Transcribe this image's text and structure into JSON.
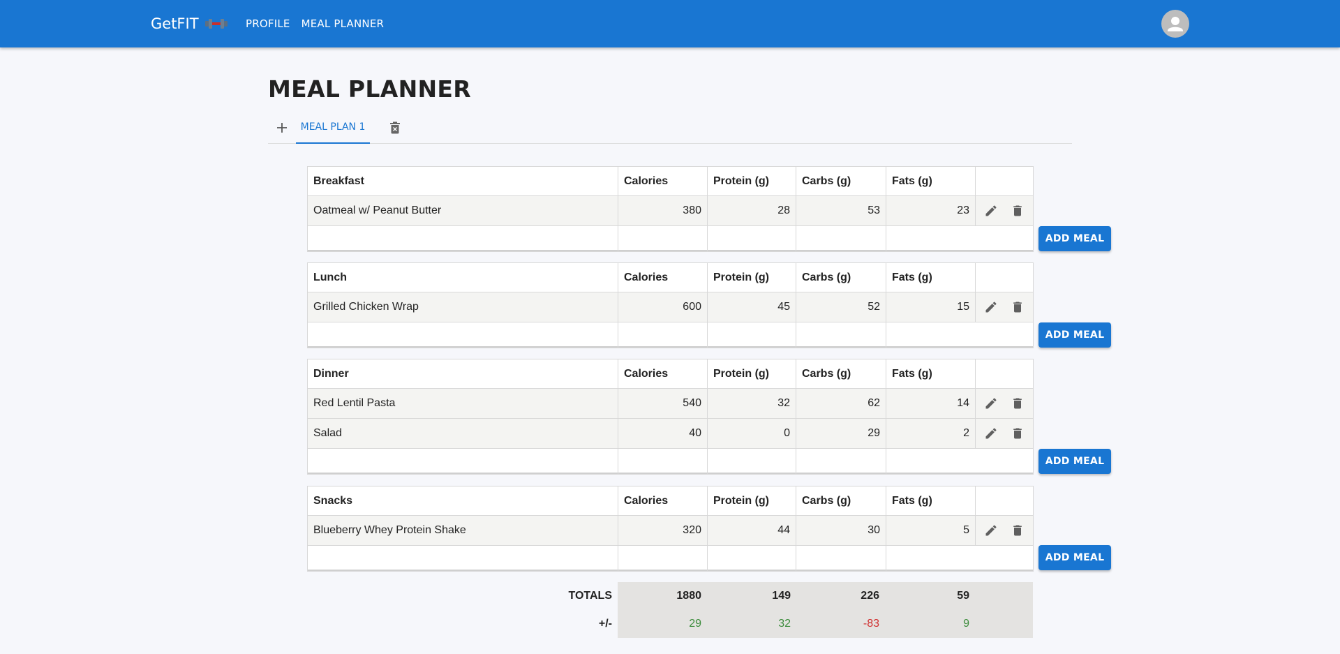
{
  "header": {
    "brand": "GetFIT",
    "nav": [
      "PROFILE",
      "MEAL PLANNER"
    ]
  },
  "page": {
    "title": "MEAL PLANNER",
    "tabs": [
      "MEAL PLAN 1"
    ]
  },
  "columns": {
    "calories": "Calories",
    "protein": "Protein (g)",
    "carbs": "Carbs (g)",
    "fats": "Fats (g)"
  },
  "add_meal_label": "ADD MEAL",
  "sections": [
    {
      "title": "Breakfast",
      "items": [
        {
          "name": "Oatmeal w/ Peanut Butter",
          "calories": "380",
          "protein": "28",
          "carbs": "53",
          "fats": "23"
        }
      ]
    },
    {
      "title": "Lunch",
      "items": [
        {
          "name": "Grilled Chicken Wrap",
          "calories": "600",
          "protein": "45",
          "carbs": "52",
          "fats": "15"
        }
      ]
    },
    {
      "title": "Dinner",
      "items": [
        {
          "name": "Red Lentil Pasta",
          "calories": "540",
          "protein": "32",
          "carbs": "62",
          "fats": "14"
        },
        {
          "name": "Salad",
          "calories": "40",
          "protein": "0",
          "carbs": "29",
          "fats": "2"
        }
      ]
    },
    {
      "title": "Snacks",
      "items": [
        {
          "name": "Blueberry Whey Protein Shake",
          "calories": "320",
          "protein": "44",
          "carbs": "30",
          "fats": "5"
        }
      ]
    }
  ],
  "totals": {
    "label": "TOTALS",
    "calories": "1880",
    "protein": "149",
    "carbs": "226",
    "fats": "59"
  },
  "diff": {
    "label": "+/-",
    "calories": "29",
    "protein": "32",
    "carbs": "-83",
    "fats": "9"
  },
  "colors": {
    "primary": "#1976d2",
    "positive": "#3c8c3c",
    "negative": "#d03030"
  }
}
